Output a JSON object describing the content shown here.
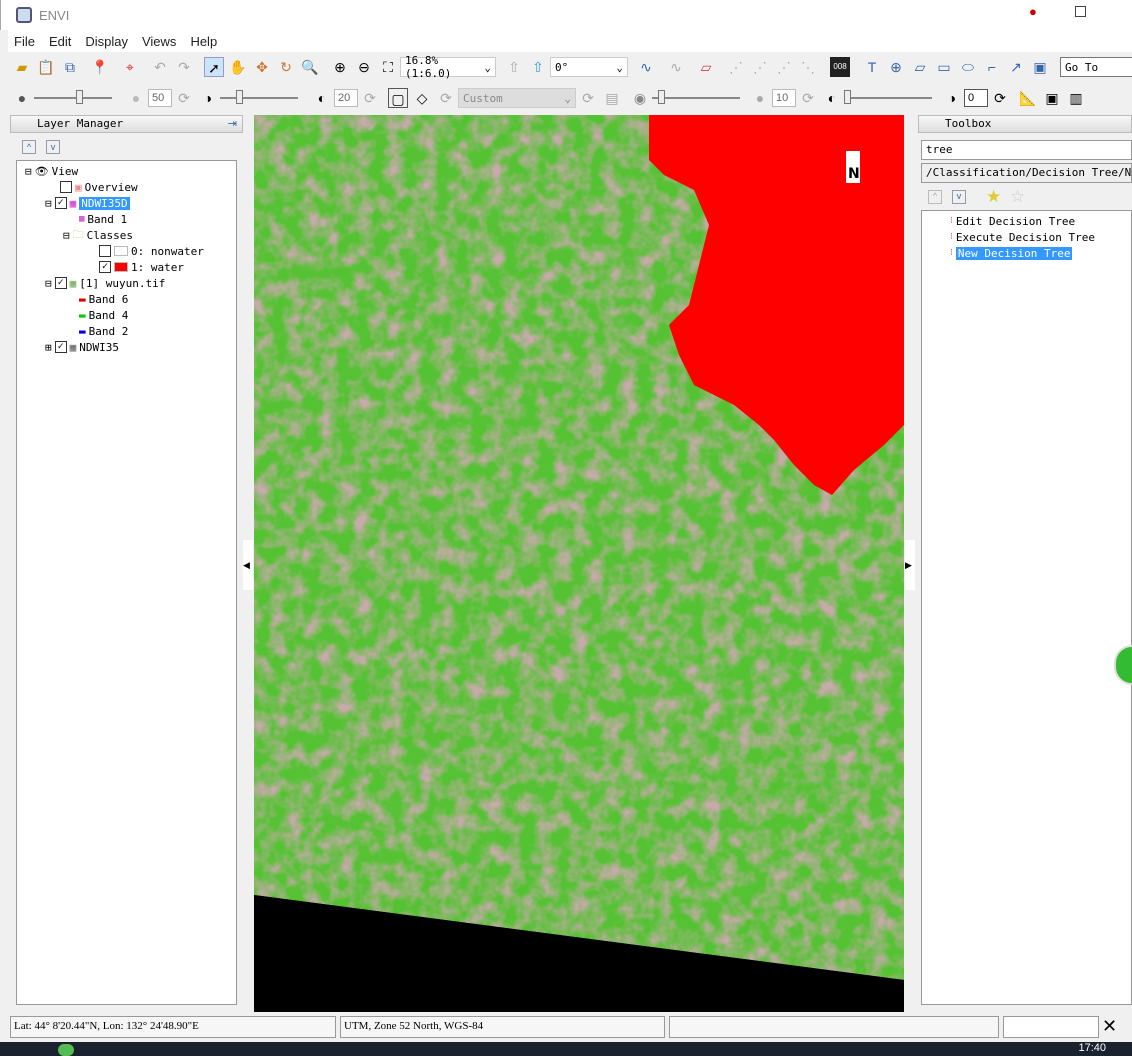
{
  "app": {
    "title": "ENVI"
  },
  "menu": [
    "File",
    "Edit",
    "Display",
    "Views",
    "Help"
  ],
  "toolbar": {
    "zoom_value": "16.8% (1:6.0)",
    "rotation_value": "0°",
    "goto_placeholder": "Go To",
    "brightness": "50",
    "contrast": "20",
    "stretch": "Custom",
    "sharpen": "10",
    "transparency": "0"
  },
  "layer_manager": {
    "title": "Layer Manager",
    "items": [
      {
        "label": "View"
      },
      {
        "label": "Overview"
      },
      {
        "label": "NDWI35D"
      },
      {
        "label": "Band 1"
      },
      {
        "label": "Classes"
      },
      {
        "label": "0: nonwater"
      },
      {
        "label": "1: water"
      },
      {
        "label": "[1] wuyun.tif"
      },
      {
        "label": "Band 6"
      },
      {
        "label": "Band 4"
      },
      {
        "label": "Band 2"
      },
      {
        "label": "NDWI35"
      }
    ]
  },
  "toolbox": {
    "title": "Toolbox",
    "search": "tree",
    "path": "/Classification/Decision Tree/New Decision Tree",
    "items": [
      "Edit Decision Tree",
      "Execute Decision Tree",
      "New Decision Tree"
    ]
  },
  "map": {
    "north_label": "N",
    "colors": {
      "water": "#ff0000",
      "vegetation": "#5ec83a",
      "nodata": "#000000"
    }
  },
  "status": {
    "latlon": "Lat: 44° 8'20.44\"N, Lon: 132° 24'48.90\"E",
    "projection": "UTM, Zone 52 North, WGS-84",
    "third": ""
  },
  "taskbar": {
    "clock": "17:40"
  }
}
